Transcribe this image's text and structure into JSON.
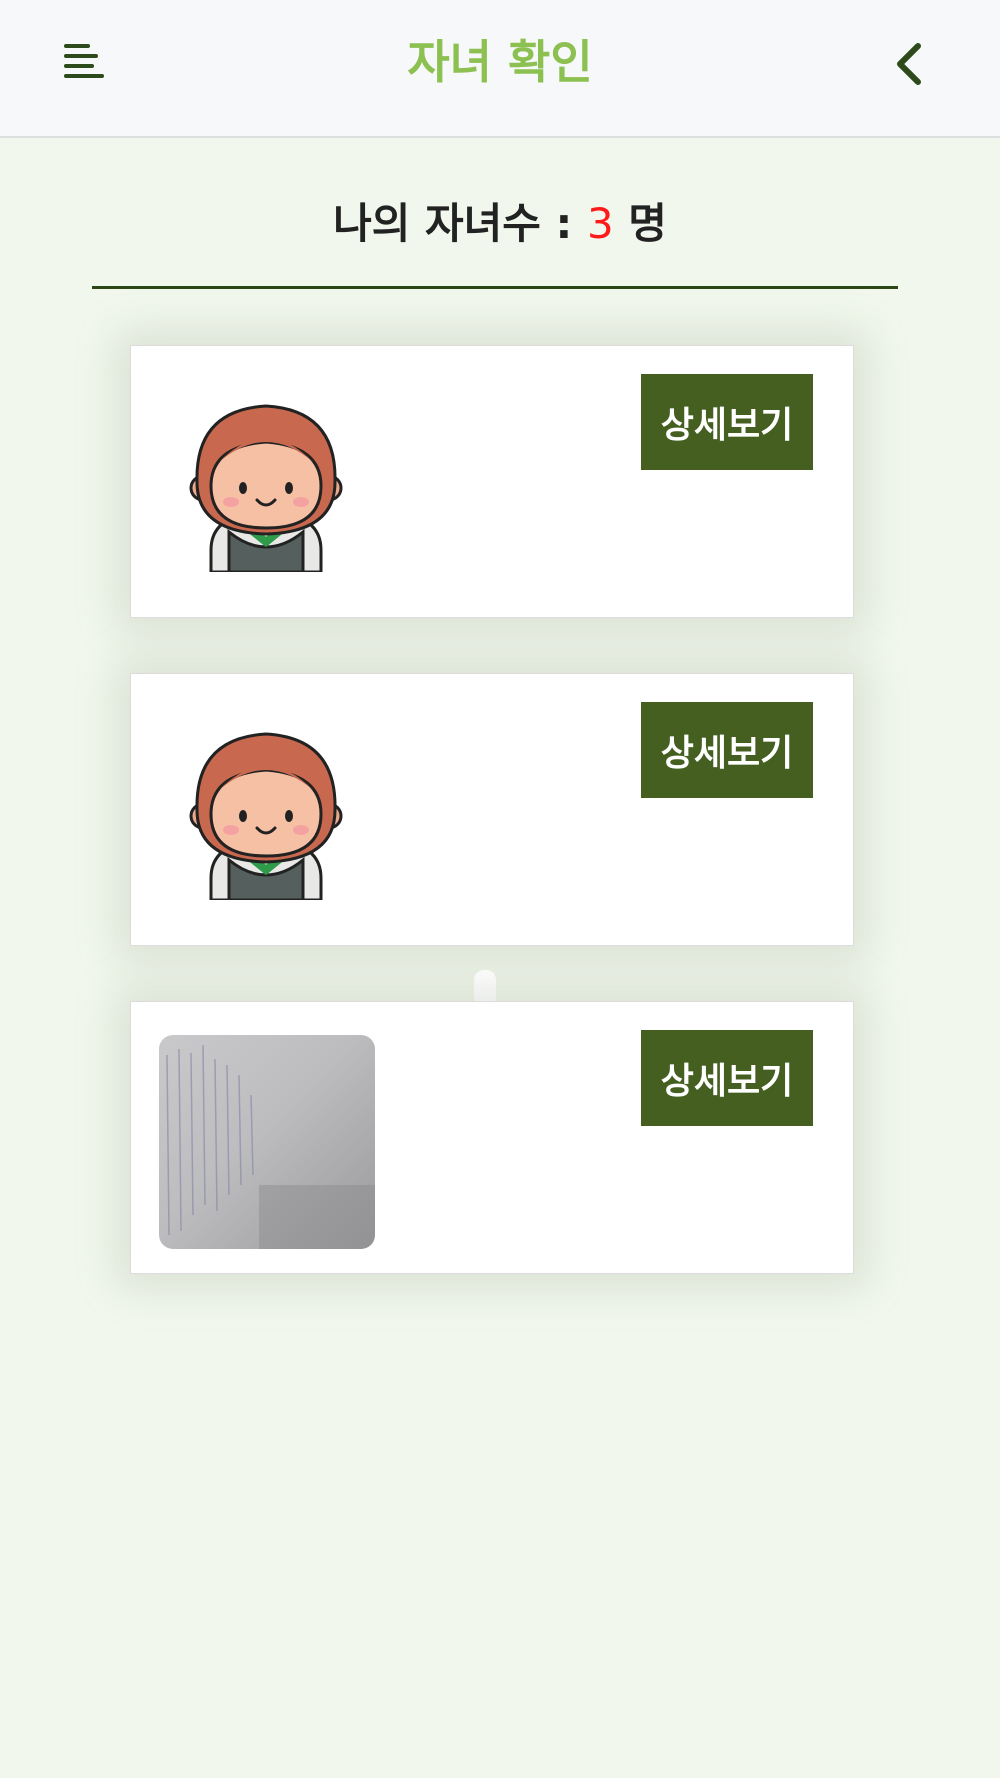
{
  "header": {
    "title": "자녀 확인",
    "menu_icon": "hamburger-menu-icon",
    "back_icon": "chevron-left-icon"
  },
  "summary": {
    "label": "나의 자녀수 : ",
    "count": "3",
    "unit": " 명"
  },
  "children": [
    {
      "image": "avatar-icon",
      "detail_label": "상세보기"
    },
    {
      "image": "avatar-icon",
      "detail_label": "상세보기"
    },
    {
      "image": "photo",
      "detail_label": "상세보기"
    }
  ],
  "colors": {
    "title": "#8cc152",
    "button": "#445f20",
    "count": "#ff1a1a",
    "background": "#f1f7ec"
  }
}
